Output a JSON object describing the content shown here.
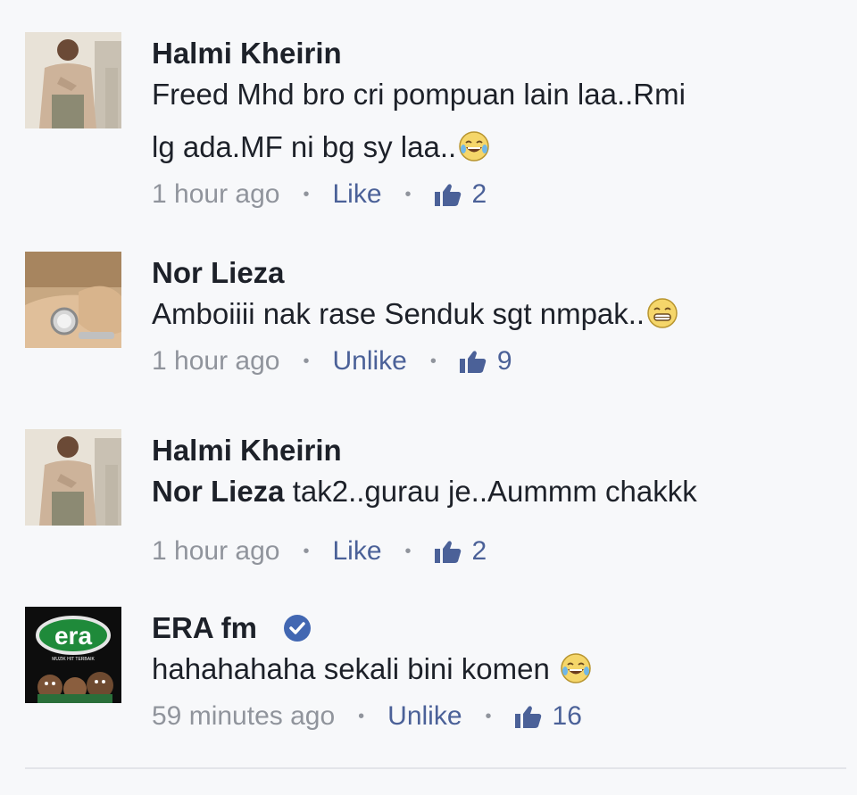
{
  "comments": [
    {
      "author": "Halmi Kheirin",
      "text_line1": "Freed Mhd bro cri pompuan lain laa..Rmi",
      "text_line2": "lg ada.MF ni bg sy laa..",
      "emoji": "laughing-tears-emoji",
      "time": "1 hour ago",
      "action": "Like",
      "likes": "2"
    },
    {
      "author": "Nor Lieza",
      "text_line1": "Amboiiii nak rase Senduk sgt nmpak..",
      "emoji": "grinning-emoji",
      "time": "1 hour ago",
      "action": "Unlike",
      "likes": "9"
    },
    {
      "author": "Halmi Kheirin",
      "mention": "Nor Lieza",
      "text_line1": " tak2..gurau je..Aummm chakkk",
      "time": "1 hour ago",
      "action": "Like",
      "likes": "2"
    },
    {
      "author": "ERA fm",
      "verified": true,
      "text_line1": "hahahahaha sekali bini komen ",
      "emoji": "laughing-tears-emoji",
      "time": "59 minutes ago",
      "action": "Unlike",
      "likes": "16",
      "avatar_logo": "era",
      "avatar_tagline": "MUZIK HIT TERBAIK"
    }
  ],
  "separator": "•",
  "colors": {
    "text": "#1d2129",
    "meta": "#90949c",
    "link": "#4b6198",
    "verified": "#4267b2",
    "era_green": "#1f8a3a"
  }
}
